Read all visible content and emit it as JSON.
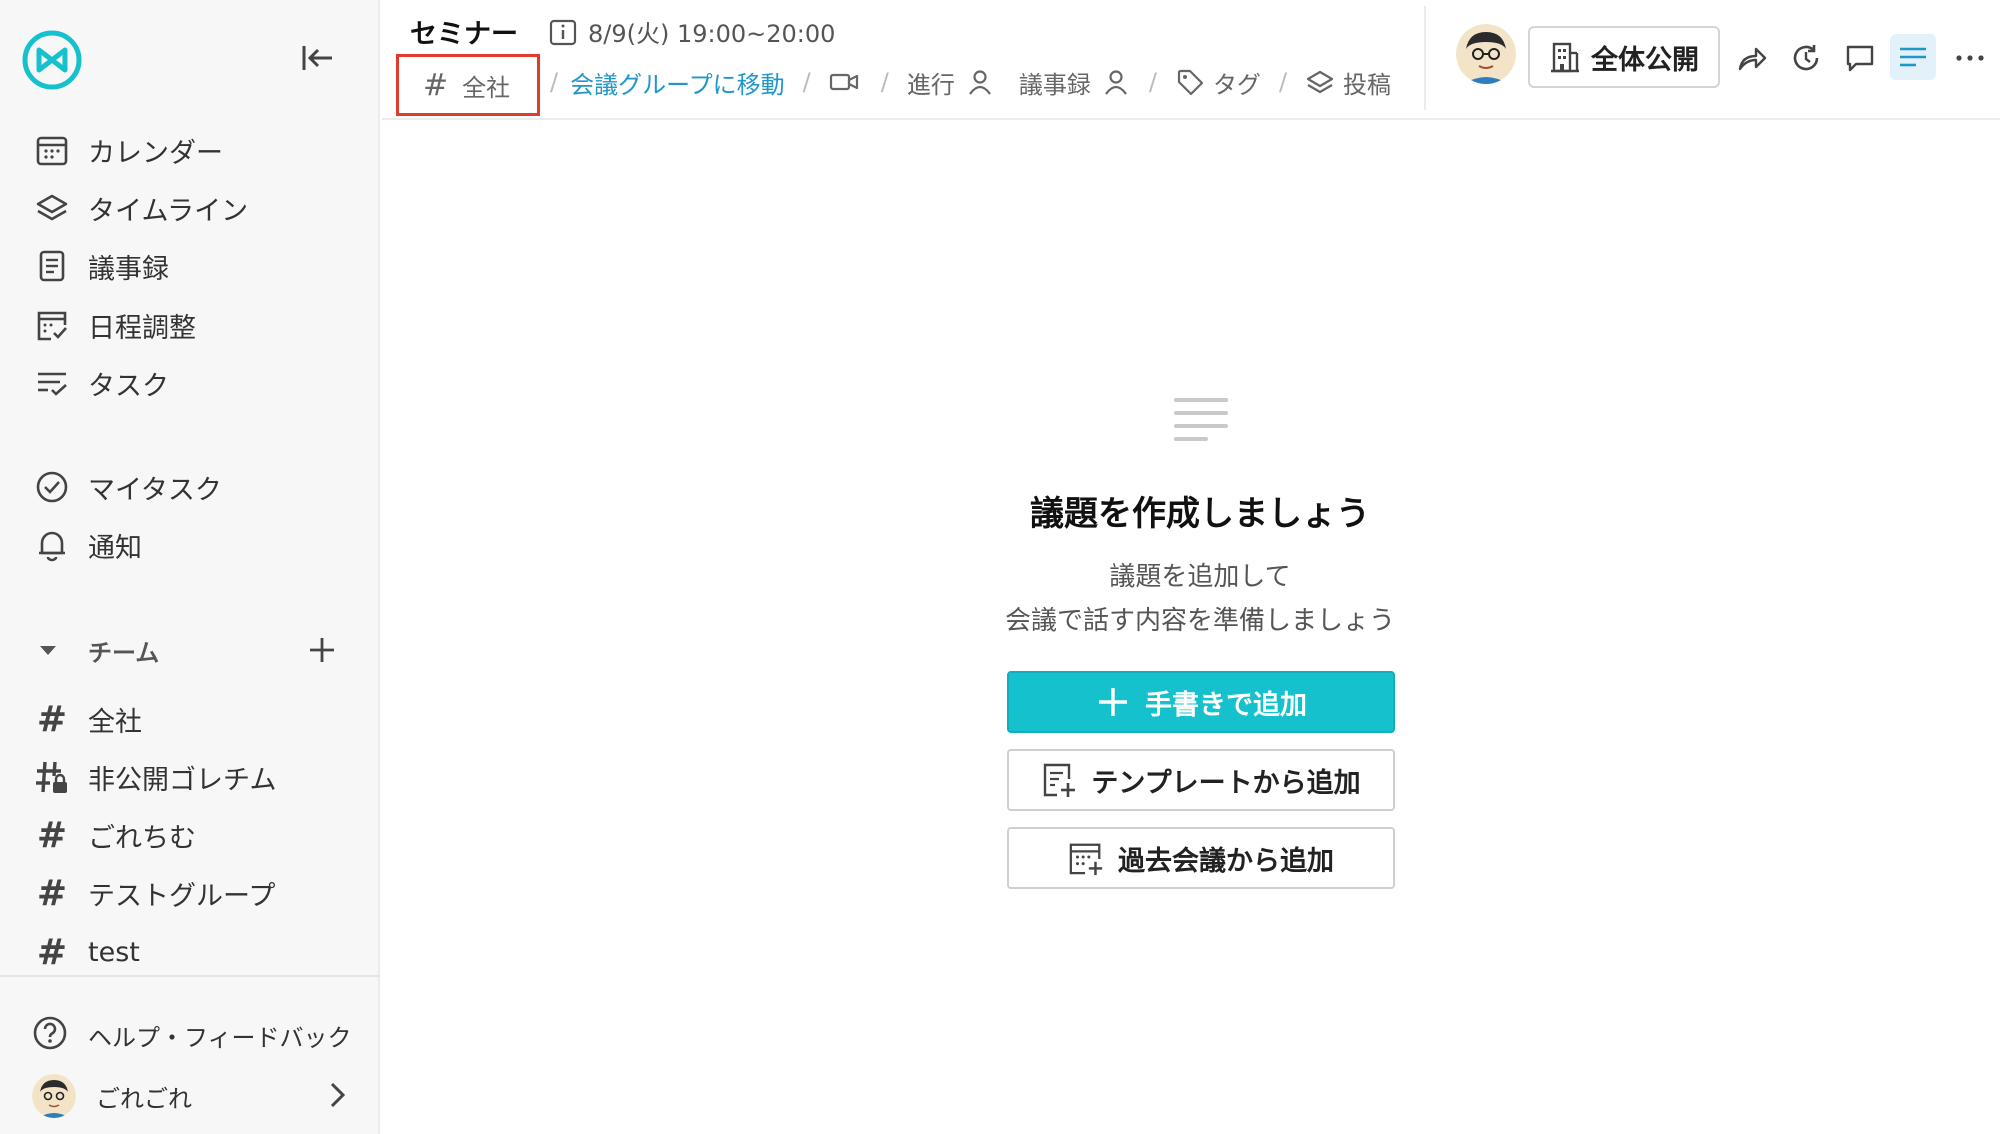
{
  "sidebar": {
    "nav": [
      {
        "label": "カレンダー",
        "icon": "calendar-icon"
      },
      {
        "label": "タイムライン",
        "icon": "layers-icon"
      },
      {
        "label": "議事録",
        "icon": "document-icon"
      },
      {
        "label": "日程調整",
        "icon": "schedule-check-icon"
      },
      {
        "label": "タスク",
        "icon": "task-list-icon"
      }
    ],
    "personal": [
      {
        "label": "マイタスク",
        "icon": "check-circle-icon"
      },
      {
        "label": "通知",
        "icon": "bell-icon"
      }
    ],
    "team_header": "チーム",
    "teams": [
      {
        "label": "全社",
        "icon": "hash-icon"
      },
      {
        "label": "非公開ゴレチム",
        "icon": "hash-lock-icon"
      },
      {
        "label": "ごれちむ",
        "icon": "hash-icon"
      },
      {
        "label": "テストグループ",
        "icon": "hash-icon"
      },
      {
        "label": "test",
        "icon": "hash-icon"
      }
    ],
    "help_label": "ヘルプ・フィードバック",
    "user_name": "ごれごれ"
  },
  "header": {
    "title": "セミナー",
    "date": "8/9(火) 19:00~20:00",
    "channel": "全社",
    "move_link": "会議グループに移動",
    "facilitator_label": "進行",
    "minutes_label": "議事録",
    "tag_label": "タグ",
    "post_label": "投稿",
    "visibility_label": "全体公開"
  },
  "empty_state": {
    "title": "議題を作成しましょう",
    "subtitle_line1": "議題を追加して",
    "subtitle_line2": "会議で話す内容を準備しましょう",
    "add_manual": "手書きで追加",
    "add_template": "テンプレートから追加",
    "add_past": "過去会議から追加"
  },
  "colors": {
    "accent": "#14c1cd",
    "link": "#2196c9",
    "highlight_box": "#e23a2c"
  }
}
